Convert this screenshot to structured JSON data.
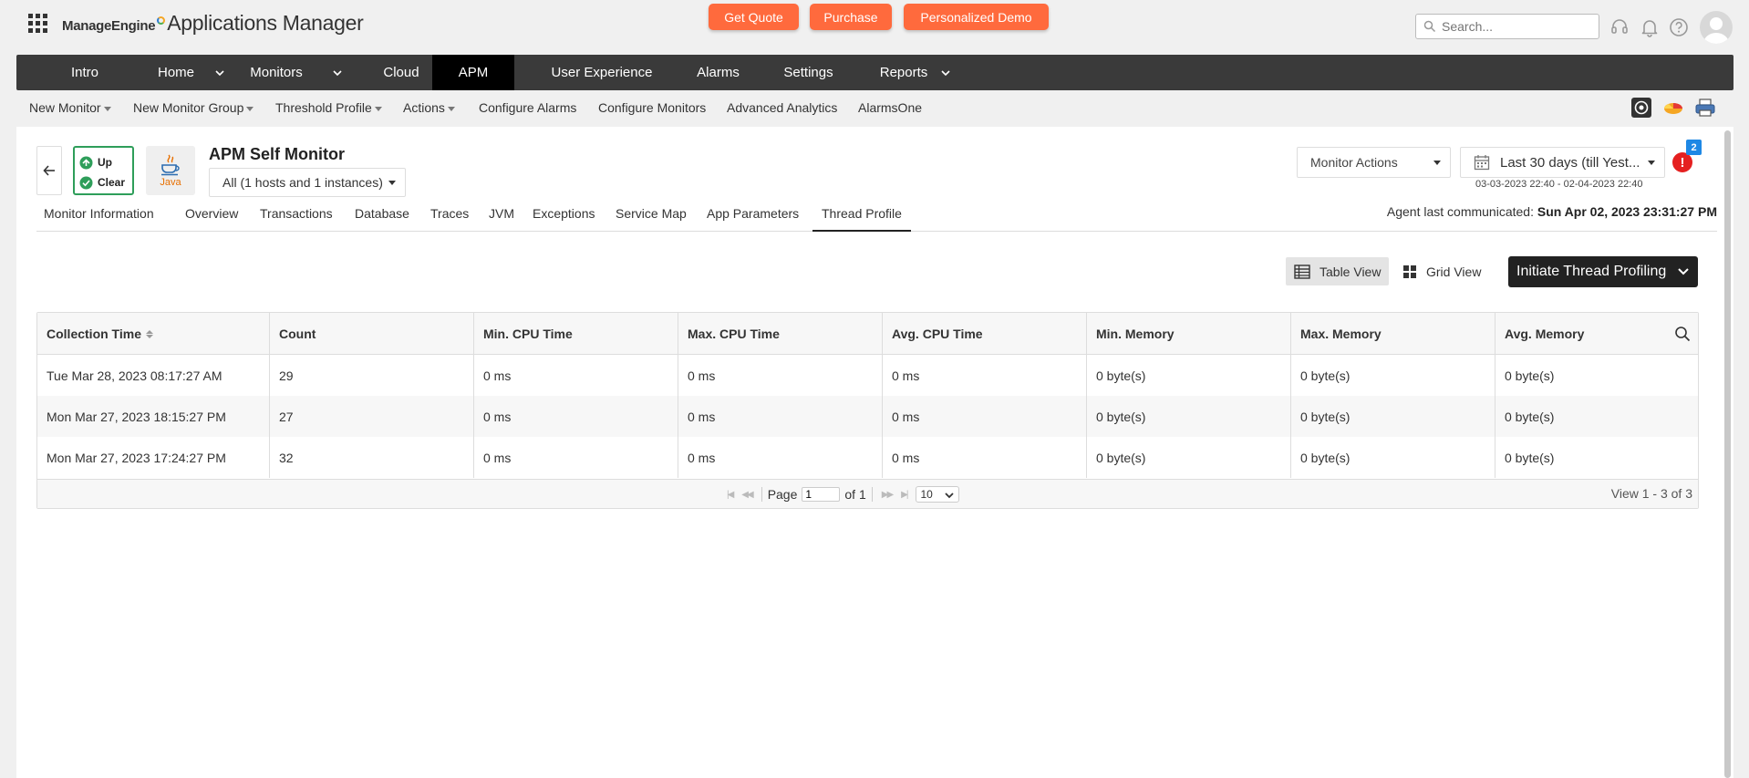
{
  "brand": {
    "company": "ManageEngine",
    "product": "Applications Manager"
  },
  "cta": {
    "quote": "Get Quote",
    "purchase": "Purchase",
    "demo": "Personalized Demo"
  },
  "search": {
    "placeholder": "Search..."
  },
  "nav": [
    "Intro",
    "Home",
    "Monitors",
    "Cloud",
    "APM",
    "User Experience",
    "Alarms",
    "Settings",
    "Reports"
  ],
  "nav_active": "APM",
  "subnav": [
    "New Monitor",
    "New Monitor Group",
    "Threshold Profile",
    "Actions",
    "Configure Alarms",
    "Configure Monitors",
    "Advanced Analytics",
    "AlarmsOne"
  ],
  "monitor": {
    "status_up": "Up",
    "status_clear": "Clear",
    "java_label": "Java",
    "title": "APM Self Monitor",
    "instances": "All (1 hosts and 1 instances)",
    "actions": "Monitor Actions",
    "period": "Last 30 days (till Yest...",
    "range": "03-03-2023 22:40 - 02-04-2023 22:40",
    "alert_count": "2",
    "alert_glyph": "!"
  },
  "tabs": [
    "Monitor Information",
    "Overview",
    "Transactions",
    "Database",
    "Traces",
    "JVM",
    "Exceptions",
    "Service Map",
    "App Parameters",
    "Thread Profile"
  ],
  "tab_active": "Thread Profile",
  "agent": {
    "label": "Agent last communicated:",
    "time": "Sun Apr 02, 2023 23:31:27 PM"
  },
  "views": {
    "table": "Table View",
    "grid": "Grid View",
    "initiate": "Initiate Thread Profiling"
  },
  "table": {
    "columns": [
      "Collection Time",
      "Count",
      "Min. CPU Time",
      "Max. CPU Time",
      "Avg. CPU Time",
      "Min. Memory",
      "Max. Memory",
      "Avg. Memory"
    ],
    "rows": [
      [
        "Tue Mar 28, 2023 08:17:27 AM",
        "29",
        "0 ms",
        "0 ms",
        "0 ms",
        "0 byte(s)",
        "0 byte(s)",
        "0 byte(s)"
      ],
      [
        "Mon Mar 27, 2023 18:15:27 PM",
        "27",
        "0 ms",
        "0 ms",
        "0 ms",
        "0 byte(s)",
        "0 byte(s)",
        "0 byte(s)"
      ],
      [
        "Mon Mar 27, 2023 17:24:27 PM",
        "32",
        "0 ms",
        "0 ms",
        "0 ms",
        "0 byte(s)",
        "0 byte(s)",
        "0 byte(s)"
      ]
    ]
  },
  "pager": {
    "page_label": "Page",
    "page_value": "1",
    "of_label": "of 1",
    "rows_per_page": "10",
    "view_info": "View 1 - 3 of 3"
  },
  "colors": {
    "accent": "#ff6a3d",
    "nav_bg": "#3a3a3a",
    "status_green": "#2e9e5a",
    "alert_red": "#e52020",
    "badge_blue": "#1e88e5"
  }
}
